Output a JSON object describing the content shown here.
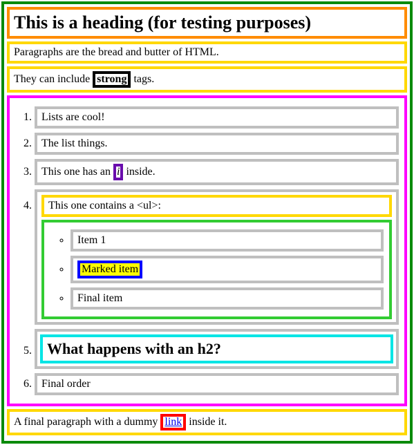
{
  "heading": "This is a heading (for testing purposes)",
  "para1": "Paragraphs are the bread and butter of HTML.",
  "para2_pre": "They can include ",
  "para2_strong": "strong",
  "para2_post": " tags.",
  "list": {
    "item1": "Lists are cool!",
    "item2": "The list things.",
    "item3_pre": "This one has an ",
    "item3_i": "i",
    "item3_post": " inside.",
    "item4_intro": "This one contains a <ul>:",
    "sub1": "Item 1",
    "sub2_mark": "Marked item",
    "sub3": "Final item",
    "item5_h2": "What happens with an h2?",
    "item6": "Final order"
  },
  "para3_pre": "A final paragraph with a dummy ",
  "para3_link": "link",
  "para3_post": " inside it."
}
